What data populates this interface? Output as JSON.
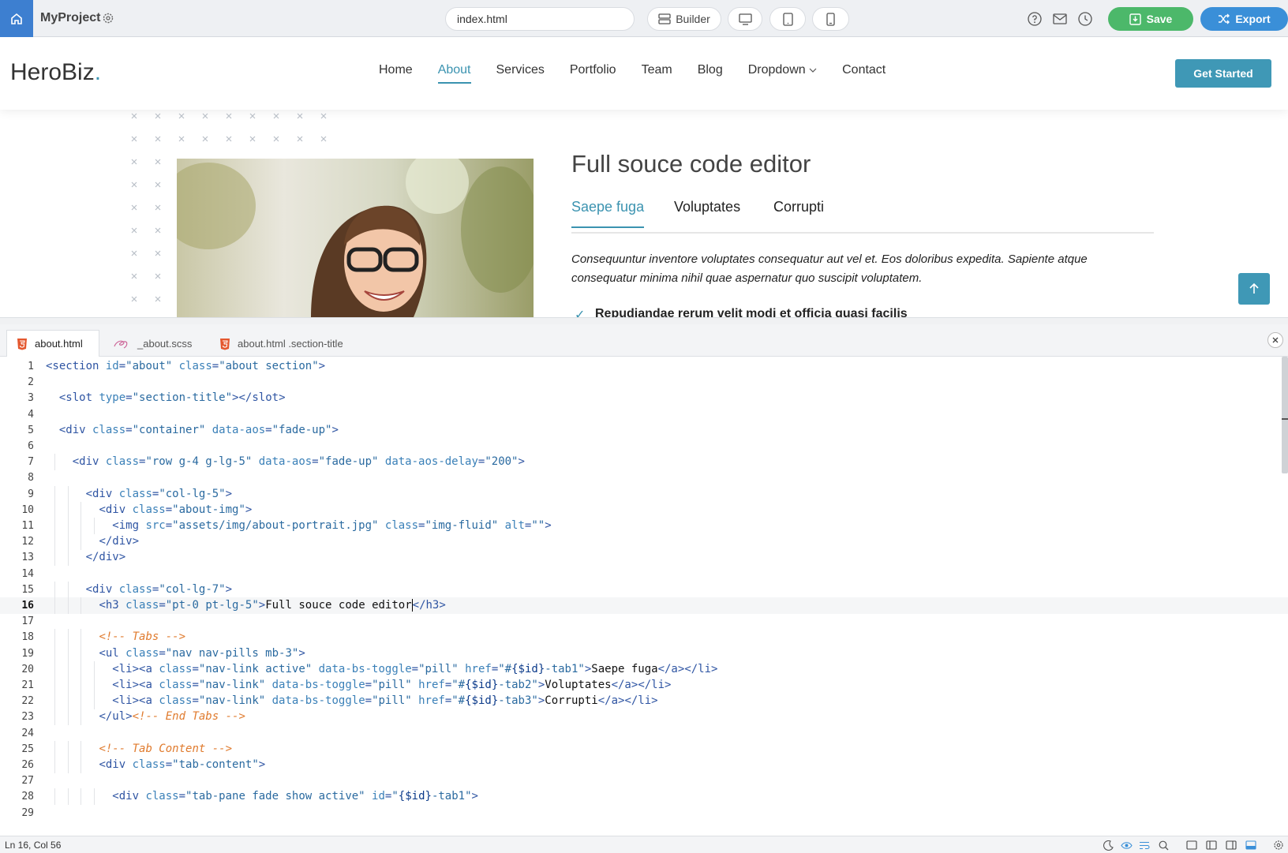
{
  "toolbar": {
    "project_name": "MyProject",
    "file_value": "index.html",
    "builder_label": "Builder",
    "save_label": "Save",
    "export_label": "Export"
  },
  "site": {
    "logo_text": "HeroBiz",
    "logo_dot": ".",
    "nav": [
      "Home",
      "About",
      "Services",
      "Portfolio",
      "Team",
      "Blog",
      "Dropdown",
      "Contact"
    ],
    "active_nav": "About",
    "cta_label": "Get Started",
    "section_title": "Full souce code editor",
    "tabs": [
      "Saepe fuga",
      "Voluptates",
      "Corrupti"
    ],
    "active_tab": "Saepe fuga",
    "tab_text": "Consequuntur inventore voluptates consequatur aut vel et. Eos doloribus expedita. Sapiente atque consequatur minima nihil quae aspernatur quo suscipit voluptatem.",
    "list_item": "Repudiandae rerum velit modi et officia quasi facilis"
  },
  "editor": {
    "tabs": [
      "about.html",
      "_about.scss",
      "about.html .section-title"
    ],
    "active_tab": "about.html",
    "current_line": 16,
    "lines": [
      "<section id=\"about\" class=\"about section\">",
      "",
      "  <slot type=\"section-title\"></slot>",
      "",
      "  <div class=\"container\" data-aos=\"fade-up\">",
      "",
      "    <div class=\"row g-4 g-lg-5\" data-aos=\"fade-up\" data-aos-delay=\"200\">",
      "",
      "      <div class=\"col-lg-5\">",
      "        <div class=\"about-img\">",
      "          <img src=\"assets/img/about-portrait.jpg\" class=\"img-fluid\" alt=\"\">",
      "        </div>",
      "      </div>",
      "",
      "      <div class=\"col-lg-7\">",
      "        <h3 class=\"pt-0 pt-lg-5\">Full souce code editor</h3>",
      "",
      "        <!-- Tabs -->",
      "        <ul class=\"nav nav-pills mb-3\">",
      "          <li><a class=\"nav-link active\" data-bs-toggle=\"pill\" href=\"#{$id}-tab1\">Saepe fuga</a></li>",
      "          <li><a class=\"nav-link\" data-bs-toggle=\"pill\" href=\"#{$id}-tab2\">Voluptates</a></li>",
      "          <li><a class=\"nav-link\" data-bs-toggle=\"pill\" href=\"#{$id}-tab3\">Corrupti</a></li>",
      "        </ul><!-- End Tabs -->",
      "",
      "        <!-- Tab Content -->",
      "        <div class=\"tab-content\">",
      "",
      "          <div class=\"tab-pane fade show active\" id=\"{$id}-tab1\">",
      ""
    ]
  },
  "status": {
    "cursor_pos": "Ln 16, Col 56"
  },
  "icons": {
    "home": "home-icon",
    "settings": "gear-icon",
    "builder": "layers-icon",
    "desktop": "desktop-icon",
    "tablet": "tablet-icon",
    "mobile": "mobile-icon",
    "help": "help-icon",
    "mail": "mail-icon",
    "history": "clock-icon",
    "save": "save-icon",
    "export": "shuffle-icon",
    "scroll_top": "arrow-up-icon",
    "close": "close-icon"
  },
  "colors": {
    "home_button": "#3d7fd0",
    "save_button": "#4cb86a",
    "export_button": "#3a8fd8",
    "brand_accent": "#3b93b0"
  }
}
